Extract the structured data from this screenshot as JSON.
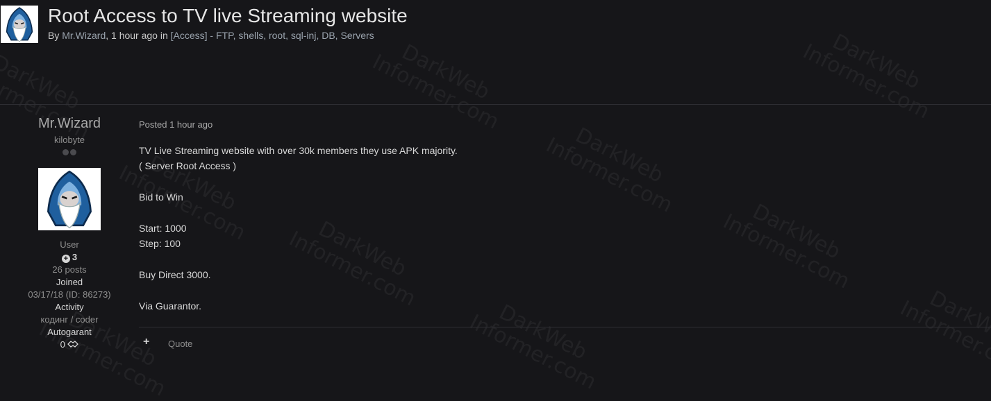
{
  "topic": {
    "title": "Root Access to TV live Streaming website",
    "meta_by": "By ",
    "author": "Mr.Wizard",
    "meta_time": ", 1 hour ago in ",
    "forum": "[Access] - FTP, shells, root, sql-inj, DB, Servers"
  },
  "author_panel": {
    "username": "Mr.Wizard",
    "rank": "kilobyte",
    "group": "User",
    "reputation": "3",
    "posts": "26 posts",
    "joined_label": "Joined",
    "joined_value": "03/17/18 (ID: 86273)",
    "activity_label": "Activity",
    "activity_value": "кодинг / coder",
    "autogarant_label": "Autogarant",
    "autogarant_value": "0"
  },
  "post": {
    "posted": "Posted 1 hour ago",
    "lines": [
      "TV Live Streaming website with over 30k members they use APK majority.",
      "( Server Root Access )",
      "Bid to Win",
      "Start: 1000",
      "Step: 100",
      "Buy Direct 3000.",
      "Via Guarantor."
    ],
    "quote_label": "Quote",
    "plus_label": "+"
  },
  "watermark": {
    "line1": "DarkWeb",
    "line2": "Informer.com"
  },
  "icons": {
    "avatar": "wizard-avatar-icon",
    "reputation": "plus-circle-icon",
    "autogarant": "handshake-icon",
    "add": "plus-icon"
  }
}
